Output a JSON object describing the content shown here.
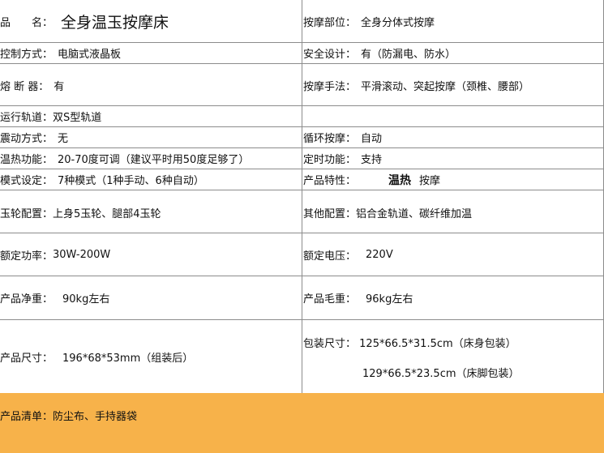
{
  "rows": [
    {
      "l_label": "品　　名：",
      "l_value": "全身温玉按摩床",
      "r_label": "按摩部位：",
      "r_value": "全身分体式按摩"
    },
    {
      "l_label": "控制方式：",
      "l_value": "电脑式液晶板",
      "r_label": "安全设计：",
      "r_value": "有（防漏电、防水）"
    },
    {
      "l_label": "熔 断 器：",
      "l_value": "有",
      "r_label": "按摩手法：",
      "r_value": "平滑滚动、突起按摩（颈椎、腰部）"
    },
    {
      "l_label": "运行轨道：",
      "l_value": "双S型轨道",
      "r_label": "",
      "r_value": ""
    },
    {
      "l_label": "震动方式：",
      "l_value": "无",
      "r_label": "循环按摩：",
      "r_value": "自动"
    },
    {
      "l_label": "温热功能：",
      "l_value": "20-70度可调（建议平时用50度足够了）",
      "r_label": "定时功能：",
      "r_value": "支持"
    },
    {
      "l_label": "模式设定：",
      "l_value": "7种模式（1种手动、6种自动）",
      "r_label": "产品特性：",
      "r_value_bold": "温热",
      "r_value": "按摩"
    },
    {
      "l_label": "玉轮配置：",
      "l_value": "上身5玉轮、腿部4玉轮",
      "r_label": "其他配置：",
      "r_value": "铝合金轨道、碳纤维加温"
    },
    {
      "l_label": "额定功率：",
      "l_value": "30W-200W",
      "r_label": "额定电压：",
      "r_value": "220V"
    },
    {
      "l_label": "产品净重：",
      "l_value": "90kg左右",
      "r_label": "产品毛重：",
      "r_value": "96kg左右"
    }
  ],
  "size_row": {
    "l_label": "产品尺寸：",
    "l_value": "196*68*53mm（组装后）",
    "r_label": "包装尺寸：",
    "r_value1": "125*66.5*31.5cm（床身包装）",
    "r_value2": "129*66.5*23.5cm（床脚包装）"
  },
  "footer": {
    "label": "产品清单：",
    "value": "防尘布、手持器袋",
    "color": "#f7b24a"
  }
}
